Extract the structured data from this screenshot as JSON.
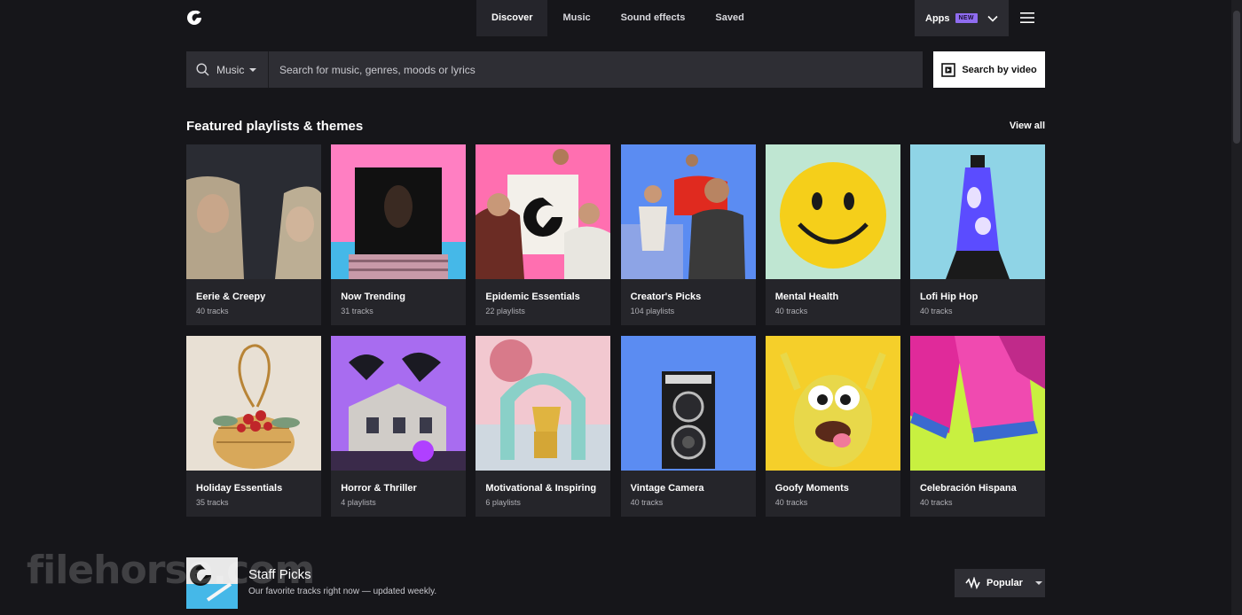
{
  "nav": {
    "items": [
      "Discover",
      "Music",
      "Sound effects",
      "Saved"
    ],
    "apps_label": "Apps",
    "apps_badge": "NEW"
  },
  "search": {
    "type_label": "Music",
    "placeholder": "Search for music, genres, moods or lyrics",
    "video_button": "Search by video"
  },
  "featured": {
    "title": "Featured playlists & themes",
    "view_all": "View all",
    "cards": [
      {
        "title": "Eerie & Creepy",
        "sub": "40 tracks"
      },
      {
        "title": "Now Trending",
        "sub": "31 tracks"
      },
      {
        "title": "Epidemic Essentials",
        "sub": "22 playlists"
      },
      {
        "title": "Creator's Picks",
        "sub": "104 playlists"
      },
      {
        "title": "Mental Health",
        "sub": "40 tracks"
      },
      {
        "title": "Lofi Hip Hop",
        "sub": "40 tracks"
      },
      {
        "title": "Holiday Essentials",
        "sub": "35 tracks"
      },
      {
        "title": "Horror & Thriller",
        "sub": "4 playlists"
      },
      {
        "title": "Motivational & Inspiring",
        "sub": "6 playlists"
      },
      {
        "title": "Vintage Camera",
        "sub": "40 tracks"
      },
      {
        "title": "Goofy Moments",
        "sub": "40 tracks"
      },
      {
        "title": "Celebración Hispana",
        "sub": "40 tracks"
      }
    ]
  },
  "staff_picks": {
    "title": "Staff Picks",
    "subtitle": "Our favorite tracks right now — updated weekly.",
    "sort_label": "Popular"
  },
  "watermark": "filehorse.com"
}
